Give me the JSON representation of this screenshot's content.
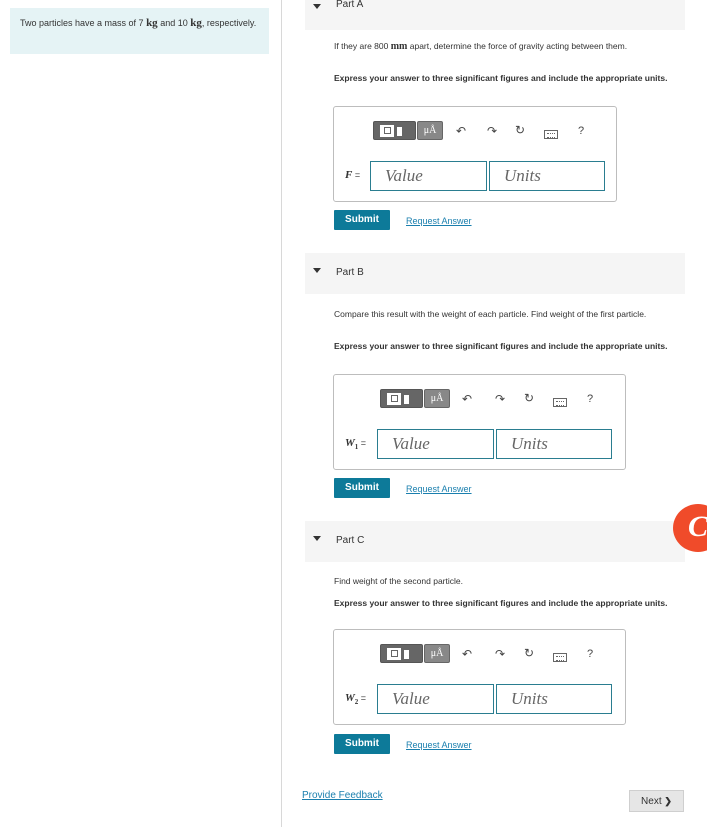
{
  "problem": {
    "pre": "Two particles have a mass of 7 ",
    "unit1": "kg",
    "mid": " and 10 ",
    "unit2": "kg",
    "post": ", respectively."
  },
  "parts": [
    {
      "title": "Part A",
      "q_pre": "If they are 800 ",
      "q_unit": "mm",
      "q_post": " apart, determine the force of gravity acting between them.",
      "instruction": "Express your answer to three significant figures and include the appropriate units.",
      "var_main": "F",
      "var_sub": "",
      "var_eq": " =",
      "value_placeholder": "Value",
      "units_placeholder": "Units",
      "submit": "Submit",
      "request": "Request Answer"
    },
    {
      "title": "Part B",
      "question": "Compare this result with the weight of each particle. Find weight of the first particle.",
      "instruction": "Express your answer to three significant figures and include the appropriate units.",
      "var_main": "W",
      "var_sub": "1",
      "var_eq": " =",
      "value_placeholder": "Value",
      "units_placeholder": "Units",
      "submit": "Submit",
      "request": "Request Answer"
    },
    {
      "title": "Part C",
      "question": "Find weight of the second particle.",
      "instruction": "Express your answer to three significant figures and include the appropriate units.",
      "var_main": "W",
      "var_sub": "2",
      "var_eq": " =",
      "value_placeholder": "Value",
      "units_placeholder": "Units",
      "submit": "Submit",
      "request": "Request Answer"
    }
  ],
  "toolbar": {
    "mu_label": "μÅ",
    "help_label": "?",
    "undo_glyph": "↶",
    "redo_glyph": "↷",
    "reset_glyph": "↻"
  },
  "footer": {
    "feedback": "Provide Feedback",
    "next": "Next",
    "next_arrow": "❯"
  },
  "badge": {
    "letter": "C",
    "color": "#f04b2a"
  }
}
